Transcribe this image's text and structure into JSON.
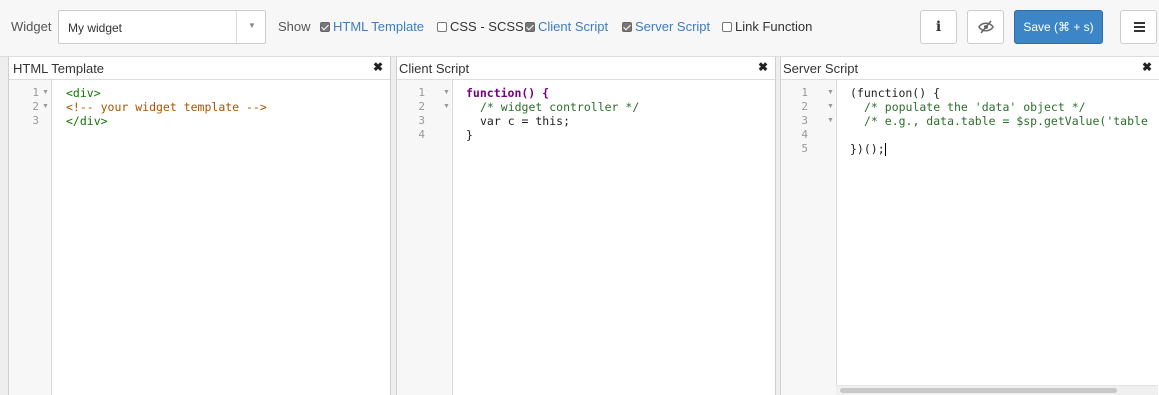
{
  "toolbar": {
    "widget_label": "Widget",
    "widget_value": "My widget",
    "show_label": "Show",
    "toggles": [
      {
        "label": "HTML Template",
        "checked": true
      },
      {
        "label": "CSS - SCSS",
        "checked": false
      },
      {
        "label": "Client Script",
        "checked": true
      },
      {
        "label": "Server Script",
        "checked": true
      },
      {
        "label": "Link Function",
        "checked": false
      }
    ],
    "info_glyph": "i",
    "save_label": "Save (⌘ + s)"
  },
  "panes": {
    "html": {
      "title": "HTML Template",
      "lines": [
        "1",
        "2",
        "3"
      ],
      "code": [
        "<div>",
        "<!-- your widget template -->",
        "</div>"
      ]
    },
    "client": {
      "title": "Client Script",
      "lines": [
        "1",
        "2",
        "3",
        "4"
      ],
      "code": [
        "function() {",
        "/* widget controller */",
        "var c = this;",
        "}"
      ]
    },
    "server": {
      "title": "Server Script",
      "lines": [
        "1",
        "2",
        "3",
        "4",
        "5"
      ],
      "code": [
        "(function() {",
        "/* populate the 'data' object */",
        "/* e.g., data.table = $sp.getValue('table",
        "",
        "})();"
      ]
    }
  },
  "colors": {
    "accent": "#3c86c8",
    "checked_text": "#3c7cbf",
    "keyword": "#770088",
    "comment": "#2c6e2c",
    "html_comment": "#aa5500",
    "tag": "#117700"
  },
  "icons": {
    "info": "info-icon",
    "eye": "eye-slash-icon",
    "menu": "hamburger-menu-icon",
    "close": "close-icon",
    "dropdown": "caret-down-icon"
  }
}
